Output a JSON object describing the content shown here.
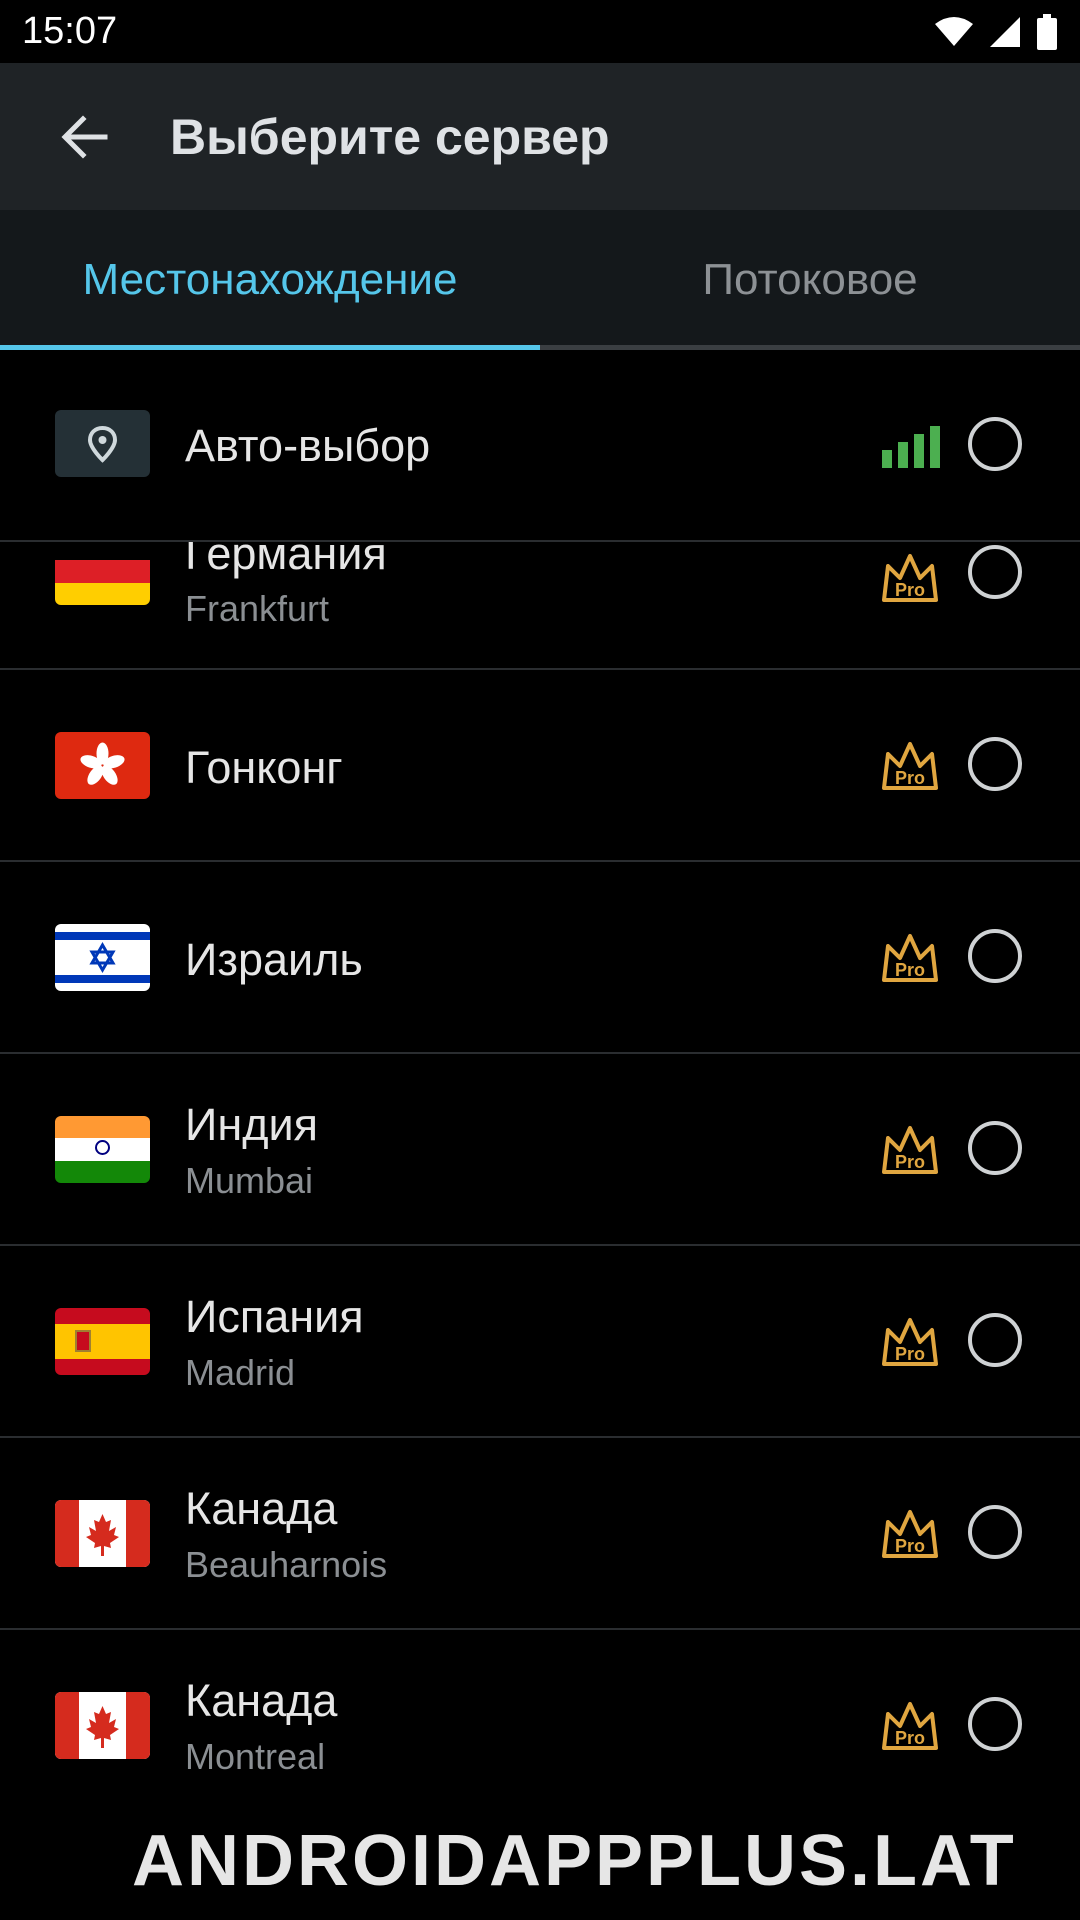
{
  "status_bar": {
    "time": "15:07"
  },
  "header": {
    "title": "Выберите сервер",
    "back_icon": "arrow-left-icon"
  },
  "tabs": [
    {
      "label": "Местонахождение",
      "active": true
    },
    {
      "label": "Потоковое",
      "active": false
    }
  ],
  "auto_select": {
    "label": "Авто-выбор",
    "icon": "location-pin-icon",
    "signal_color": "#4caf50"
  },
  "servers": [
    {
      "country": "Германия",
      "city": "Frankfurt",
      "badge": "Pro"
    },
    {
      "country": "Гонконг",
      "city": "",
      "badge": "Pro"
    },
    {
      "country": "Израиль",
      "city": "",
      "badge": "Pro"
    },
    {
      "country": "Индия",
      "city": "Mumbai",
      "badge": "Pro"
    },
    {
      "country": "Испания",
      "city": "Madrid",
      "badge": "Pro"
    },
    {
      "country": "Канада",
      "city": "Beauharnois",
      "badge": "Pro"
    },
    {
      "country": "Канада",
      "city": "Montreal",
      "badge": "Pro"
    }
  ],
  "watermark": "ANDROIDAPPPLUS.LAT",
  "colors": {
    "accent": "#55c6ea",
    "pro_gold": "#e0a640",
    "appbar_bg": "#1f2326"
  }
}
